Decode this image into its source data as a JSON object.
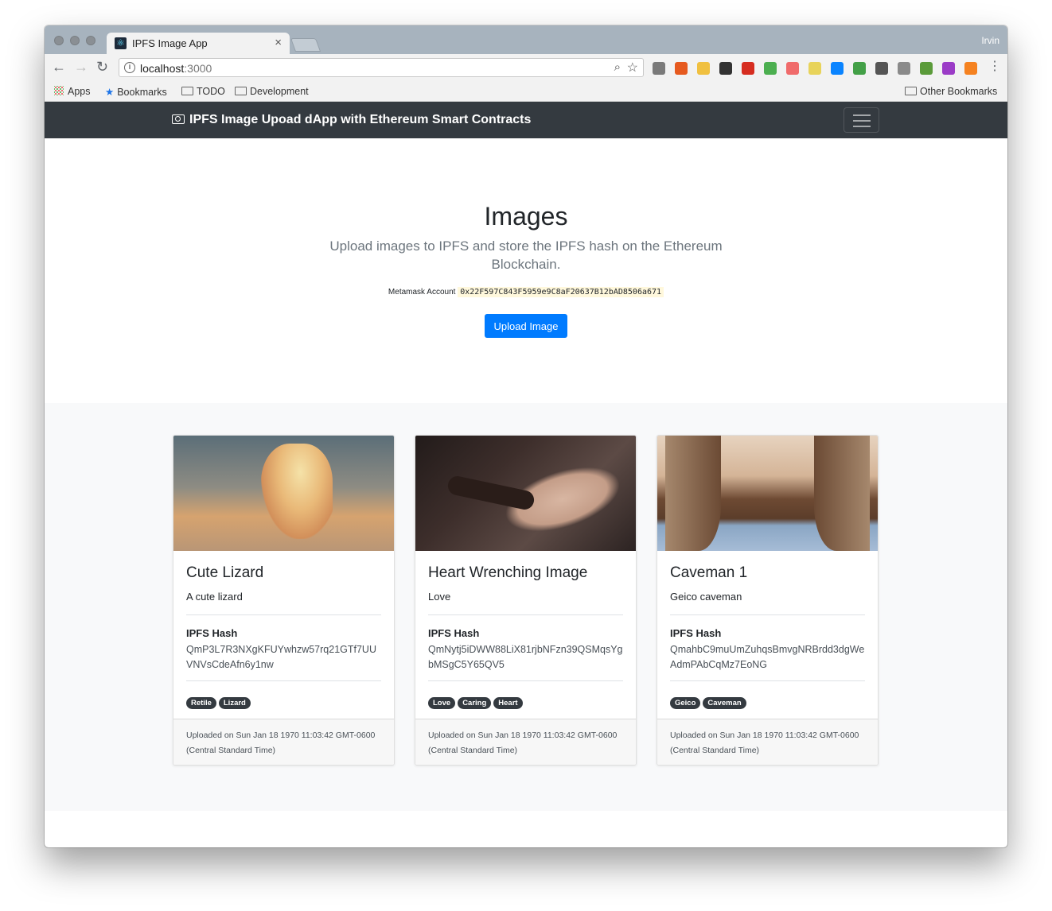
{
  "browser": {
    "tab_title": "IPFS Image App",
    "tab_close": "×",
    "profile_name": "Irvin",
    "url_host": "localhost",
    "url_port": ":3000",
    "nav_back": "←",
    "nav_forward": "→",
    "nav_reload": "↻",
    "bookmarks": {
      "apps": "Apps",
      "bookmarks": "Bookmarks",
      "todo": "TODO",
      "development": "Development",
      "other": "Other Bookmarks"
    },
    "extension_colors": [
      "#7a7a7a",
      "#e65a1f",
      "#f0c040",
      "#333333",
      "#d62d20",
      "#4caf50",
      "#f06b6b",
      "#e8d35a",
      "#0a84ff",
      "#43a047",
      "#555555",
      "#8a8a8a",
      "#5b9b3a",
      "#9b3cc7",
      "#f58220"
    ]
  },
  "navbar": {
    "brand": "IPFS Image Upoad dApp with Ethereum Smart Contracts"
  },
  "jumbotron": {
    "title": "Images",
    "lead": "Upload images to IPFS and store the IPFS hash on the Ethereum Blockchain.",
    "account_label": "Metamask Account",
    "account_address": "0x22F597C843F5959e9C8aF20637B12bAD8506a671",
    "upload_button": "Upload Image"
  },
  "cards": [
    {
      "title": "Cute Lizard",
      "description": "A cute lizard",
      "hash_label": "IPFS Hash",
      "hash": "QmP3L7R3NXgKFUYwhzw57rq21GTf7UUVNVsCdeAfn6y1nw",
      "tags": [
        "Retile",
        "Lizard"
      ],
      "uploaded": "Uploaded on Sun Jan 18 1970 11:03:42 GMT-0600 (Central Standard Time)"
    },
    {
      "title": "Heart Wrenching Image",
      "description": "Love",
      "hash_label": "IPFS Hash",
      "hash": "QmNytj5iDWW88LiX81rjbNFzn39QSMqsYgbMSgC5Y65QV5",
      "tags": [
        "Love",
        "Caring",
        "Heart"
      ],
      "uploaded": "Uploaded on Sun Jan 18 1970 11:03:42 GMT-0600 (Central Standard Time)"
    },
    {
      "title": "Caveman 1",
      "description": "Geico caveman",
      "hash_label": "IPFS Hash",
      "hash": "QmahbC9muUmZuhqsBmvgNRBrdd3dgWeAdmPAbCqMz7EoNG",
      "tags": [
        "Geico",
        "Caveman"
      ],
      "uploaded": "Uploaded on Sun Jan 18 1970 11:03:42 GMT-0600 (Central Standard Time)"
    }
  ]
}
